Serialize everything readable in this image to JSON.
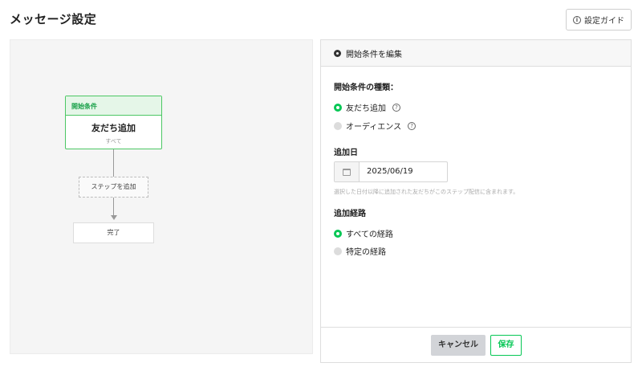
{
  "page": {
    "title": "メッセージ設定",
    "guide_button": "設定ガイド"
  },
  "flow": {
    "start_node": {
      "header": "開始条件",
      "title": "友だち追加",
      "subtitle": "すべて"
    },
    "add_step_label": "ステップを追加",
    "end_node_label": "完了"
  },
  "panel": {
    "header": "開始条件を編集",
    "condition_type_label": "開始条件の種類：",
    "condition_options": [
      {
        "label": "友だち追加",
        "selected": true
      },
      {
        "label": "オーディエンス",
        "selected": false
      }
    ],
    "date_label": "追加日",
    "date_value": "2025/06/19",
    "date_hint": "選択した日付以降に追加された友だちがこのステップ配信に含まれます。",
    "route_label": "追加経路",
    "route_options": [
      {
        "label": "すべての経路",
        "selected": true
      },
      {
        "label": "特定の経路",
        "selected": false
      }
    ],
    "cancel_button": "キャンセル",
    "save_button": "保存"
  },
  "colors": {
    "accent": "#06c755",
    "start_node_bg": "#e5f6e8",
    "cancel_bg": "#d2d4d8"
  }
}
